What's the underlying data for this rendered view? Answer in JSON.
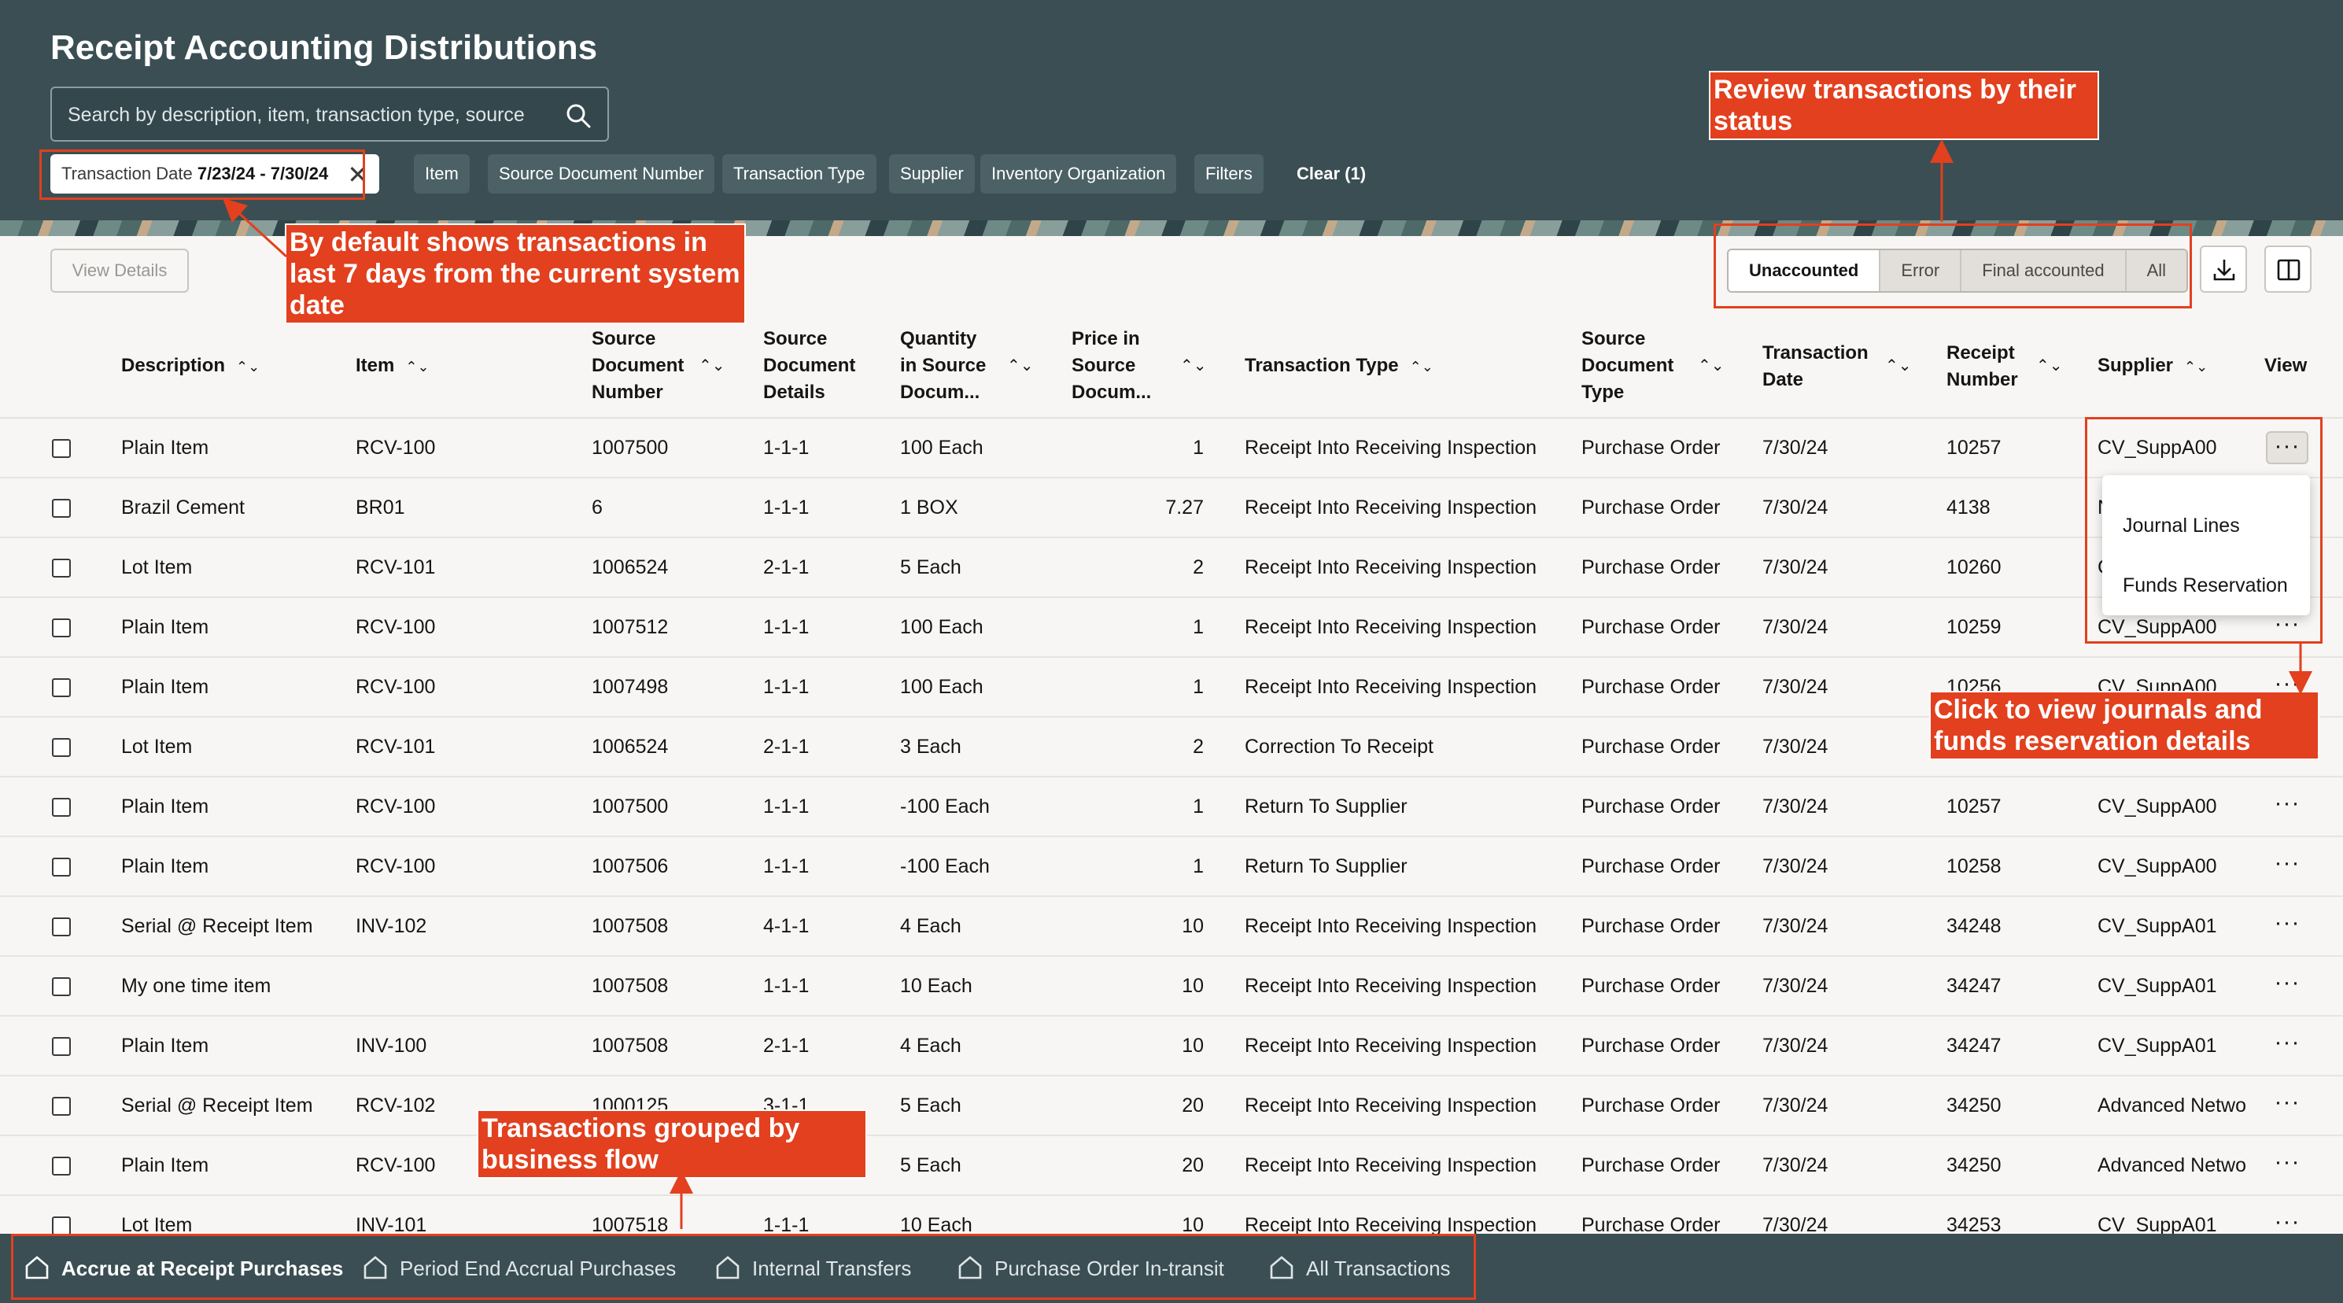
{
  "header": {
    "title": "Receipt Accounting Distributions",
    "search_placeholder": "Search by description, item, transaction type, source"
  },
  "filters": {
    "date_label": "Transaction Date",
    "date_value": "7/23/24 - 7/30/24",
    "chips": [
      "Item",
      "Source Document Number",
      "Transaction Type",
      "Supplier",
      "Inventory Organization",
      "Filters"
    ],
    "clear": "Clear (1)"
  },
  "toolbar": {
    "view_details": "View Details",
    "status_segments": [
      "Unaccounted",
      "Error",
      "Final accounted",
      "All"
    ],
    "selected_status": "Unaccounted"
  },
  "table": {
    "headers": {
      "description": "Description",
      "item": "Item",
      "source_doc_number": [
        "Source",
        "Document",
        "Number"
      ],
      "source_doc_details": [
        "Source",
        "Document",
        "Details"
      ],
      "quantity": [
        "Quantity",
        "in Source",
        "Docum..."
      ],
      "price": [
        "Price in",
        "Source",
        "Docum..."
      ],
      "transaction_type": "Transaction Type",
      "source_doc_type": [
        "Source",
        "Document",
        "Type"
      ],
      "transaction_date": [
        "Transaction",
        "Date"
      ],
      "receipt_number": [
        "Receipt",
        "Number"
      ],
      "supplier": "Supplier",
      "view": "View"
    },
    "rows": [
      {
        "description": "Plain Item",
        "item": "RCV-100",
        "doc_number": "1007500",
        "details": "1-1-1",
        "quantity": "100 Each",
        "price": "1",
        "type": "Receipt Into Receiving Inspection",
        "doc_type": "Purchase Order",
        "date": "7/30/24",
        "receipt": "10257",
        "supplier": "CV_SuppA00"
      },
      {
        "description": "Brazil Cement",
        "item": "BR01",
        "doc_number": "6",
        "details": "1-1-1",
        "quantity": "1 BOX",
        "price": "7.27",
        "type": "Receipt Into Receiving Inspection",
        "doc_type": "Purchase Order",
        "date": "7/30/24",
        "receipt": "4138",
        "supplier": "N"
      },
      {
        "description": "Lot Item",
        "item": "RCV-101",
        "doc_number": "1006524",
        "details": "2-1-1",
        "quantity": "5 Each",
        "price": "2",
        "type": "Receipt Into Receiving Inspection",
        "doc_type": "Purchase Order",
        "date": "7/30/24",
        "receipt": "10260",
        "supplier": "C"
      },
      {
        "description": "Plain Item",
        "item": "RCV-100",
        "doc_number": "1007512",
        "details": "1-1-1",
        "quantity": "100 Each",
        "price": "1",
        "type": "Receipt Into Receiving Inspection",
        "doc_type": "Purchase Order",
        "date": "7/30/24",
        "receipt": "10259",
        "supplier": "CV_SuppA00"
      },
      {
        "description": "Plain Item",
        "item": "RCV-100",
        "doc_number": "1007498",
        "details": "1-1-1",
        "quantity": "100 Each",
        "price": "1",
        "type": "Receipt Into Receiving Inspection",
        "doc_type": "Purchase Order",
        "date": "7/30/24",
        "receipt": "10256",
        "supplier": "CV_SuppA00"
      },
      {
        "description": "Lot Item",
        "item": "RCV-101",
        "doc_number": "1006524",
        "details": "2-1-1",
        "quantity": "3 Each",
        "price": "2",
        "type": "Correction To Receipt",
        "doc_type": "Purchase Order",
        "date": "7/30/24",
        "receipt": "",
        "supplier": ""
      },
      {
        "description": "Plain Item",
        "item": "RCV-100",
        "doc_number": "1007500",
        "details": "1-1-1",
        "quantity": "-100 Each",
        "price": "1",
        "type": "Return To Supplier",
        "doc_type": "Purchase Order",
        "date": "7/30/24",
        "receipt": "10257",
        "supplier": "CV_SuppA00"
      },
      {
        "description": "Plain Item",
        "item": "RCV-100",
        "doc_number": "1007506",
        "details": "1-1-1",
        "quantity": "-100 Each",
        "price": "1",
        "type": "Return To Supplier",
        "doc_type": "Purchase Order",
        "date": "7/30/24",
        "receipt": "10258",
        "supplier": "CV_SuppA00"
      },
      {
        "description": "Serial @ Receipt Item",
        "item": "INV-102",
        "doc_number": "1007508",
        "details": "4-1-1",
        "quantity": "4 Each",
        "price": "10",
        "type": "Receipt Into Receiving Inspection",
        "doc_type": "Purchase Order",
        "date": "7/30/24",
        "receipt": "34248",
        "supplier": "CV_SuppA01"
      },
      {
        "description": "My one time item",
        "item": "",
        "doc_number": "1007508",
        "details": "1-1-1",
        "quantity": "10 Each",
        "price": "10",
        "type": "Receipt Into Receiving Inspection",
        "doc_type": "Purchase Order",
        "date": "7/30/24",
        "receipt": "34247",
        "supplier": "CV_SuppA01"
      },
      {
        "description": "Plain Item",
        "item": "INV-100",
        "doc_number": "1007508",
        "details": "2-1-1",
        "quantity": "4 Each",
        "price": "10",
        "type": "Receipt Into Receiving Inspection",
        "doc_type": "Purchase Order",
        "date": "7/30/24",
        "receipt": "34247",
        "supplier": "CV_SuppA01"
      },
      {
        "description": "Serial @ Receipt Item",
        "item": "RCV-102",
        "doc_number": "1000125",
        "details": "3-1-1",
        "quantity": "5 Each",
        "price": "20",
        "type": "Receipt Into Receiving Inspection",
        "doc_type": "Purchase Order",
        "date": "7/30/24",
        "receipt": "34250",
        "supplier": "Advanced Netwo"
      },
      {
        "description": "Plain Item",
        "item": "RCV-100",
        "doc_number": "",
        "details": "",
        "quantity": "5 Each",
        "price": "20",
        "type": "Receipt Into Receiving Inspection",
        "doc_type": "Purchase Order",
        "date": "7/30/24",
        "receipt": "34250",
        "supplier": "Advanced Netwo"
      },
      {
        "description": "Lot Item",
        "item": "INV-101",
        "doc_number": "1007518",
        "details": "1-1-1",
        "quantity": "10 Each",
        "price": "10",
        "type": "Receipt Into Receiving Inspection",
        "doc_type": "Purchase Order",
        "date": "7/30/24",
        "receipt": "34253",
        "supplier": "CV_SuppA01"
      }
    ]
  },
  "row_menu": {
    "items": [
      "Journal Lines",
      "Funds Reservation"
    ]
  },
  "bottom_tabs": [
    "Accrue at Receipt Purchases",
    "Period End Accrual Purchases",
    "Internal Transfers",
    "Purchase Order In-transit",
    "All Transactions"
  ],
  "annotations": {
    "status_note": "Review transactions by their status",
    "default_note": "By default shows transactions in last 7 days from the current system date",
    "journals_note": "Click to view journals and funds reservation details",
    "grouped_note": "Transactions grouped by business flow"
  },
  "colors": {
    "header_bg": "#3a4e53",
    "annotation": "#e2401e"
  }
}
